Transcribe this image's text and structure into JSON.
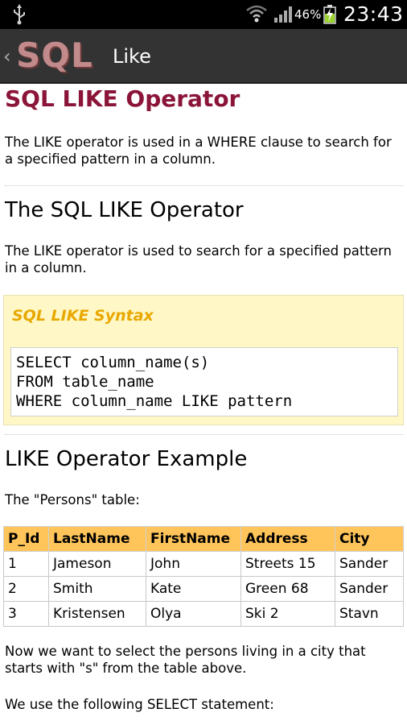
{
  "status_bar": {
    "battery_percent": "46%",
    "time": "23:43",
    "icons": [
      "usb-icon",
      "wifi-icon",
      "signal-icon",
      "battery-charging-icon"
    ]
  },
  "action_bar": {
    "back_glyph": "‹",
    "logo": "SQL",
    "title": "Like"
  },
  "page": {
    "heading": "SQL LIKE Operator",
    "intro": "The LIKE operator is used in a WHERE clause to search for a specified pattern in a column.",
    "section1_title": "The SQL LIKE Operator",
    "section1_text": "The LIKE operator is used to search for a specified pattern in a column.",
    "syntax": {
      "title": "SQL LIKE Syntax",
      "lines": [
        "SELECT column_name(s)",
        "FROM table_name",
        "WHERE column_name LIKE pattern"
      ]
    },
    "section2_title": "LIKE Operator Example",
    "table_caption": "The \"Persons\" table:",
    "table": {
      "headers": [
        "P_Id",
        "LastName",
        "FirstName",
        "Address",
        "City"
      ],
      "rows": [
        [
          "1",
          "Jameson",
          "John",
          "Streets 15",
          "Sander"
        ],
        [
          "2",
          "Smith",
          "Kate",
          "Green 68",
          "Sander"
        ],
        [
          "3",
          "Kristensen",
          "Olya",
          "Ski 2",
          "Stavn"
        ]
      ]
    },
    "after_table_text": "Now we want to select the persons living in a city that starts with \"s\" from the table above.",
    "statement_text": "We use the following SELECT statement:"
  },
  "colors": {
    "heading": "#8b1538",
    "syntax_title": "#e8a800",
    "syntax_bg": "#fff8c6",
    "table_header_bg": "#ffc55a",
    "action_bar_bg": "#333333"
  }
}
